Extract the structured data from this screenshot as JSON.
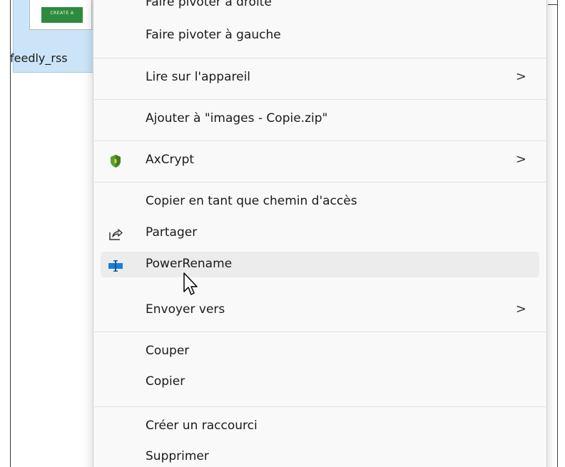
{
  "file": {
    "name": "feedly_rss",
    "thumbnail_text": "CREATE A"
  },
  "menu": {
    "items": [
      {
        "label": "Faire pivoter à droite",
        "has_submenu": false,
        "icon": null
      },
      {
        "label": "Faire pivoter à gauche",
        "has_submenu": false,
        "icon": null
      },
      {
        "label": "Lire sur l'appareil",
        "has_submenu": true,
        "icon": null
      },
      {
        "label": "Ajouter à \"images - Copie.zip\"",
        "has_submenu": false,
        "icon": null
      },
      {
        "label": "AxCrypt",
        "has_submenu": true,
        "icon": "axcrypt-shield-icon"
      },
      {
        "label": "Copier en tant que chemin d'accès",
        "has_submenu": false,
        "icon": null
      },
      {
        "label": "Partager",
        "has_submenu": false,
        "icon": "share-icon"
      },
      {
        "label": "PowerRename",
        "has_submenu": false,
        "icon": "powerrename-icon",
        "hovered": true
      },
      {
        "label": "Envoyer vers",
        "has_submenu": true,
        "icon": null
      },
      {
        "label": "Couper",
        "has_submenu": false,
        "icon": null
      },
      {
        "label": "Copier",
        "has_submenu": false,
        "icon": null
      },
      {
        "label": "Créer un raccourci",
        "has_submenu": false,
        "icon": null
      },
      {
        "label": "Supprimer",
        "has_submenu": false,
        "icon": null
      }
    ],
    "submenu_chevron": ">"
  },
  "colors": {
    "menu_background": "#f9f9f9",
    "hover_background": "#ececec",
    "selection_background": "#cce4f7",
    "axcrypt_shield": "#5aa02c",
    "powerrename_blue": "#1a7fd4"
  }
}
